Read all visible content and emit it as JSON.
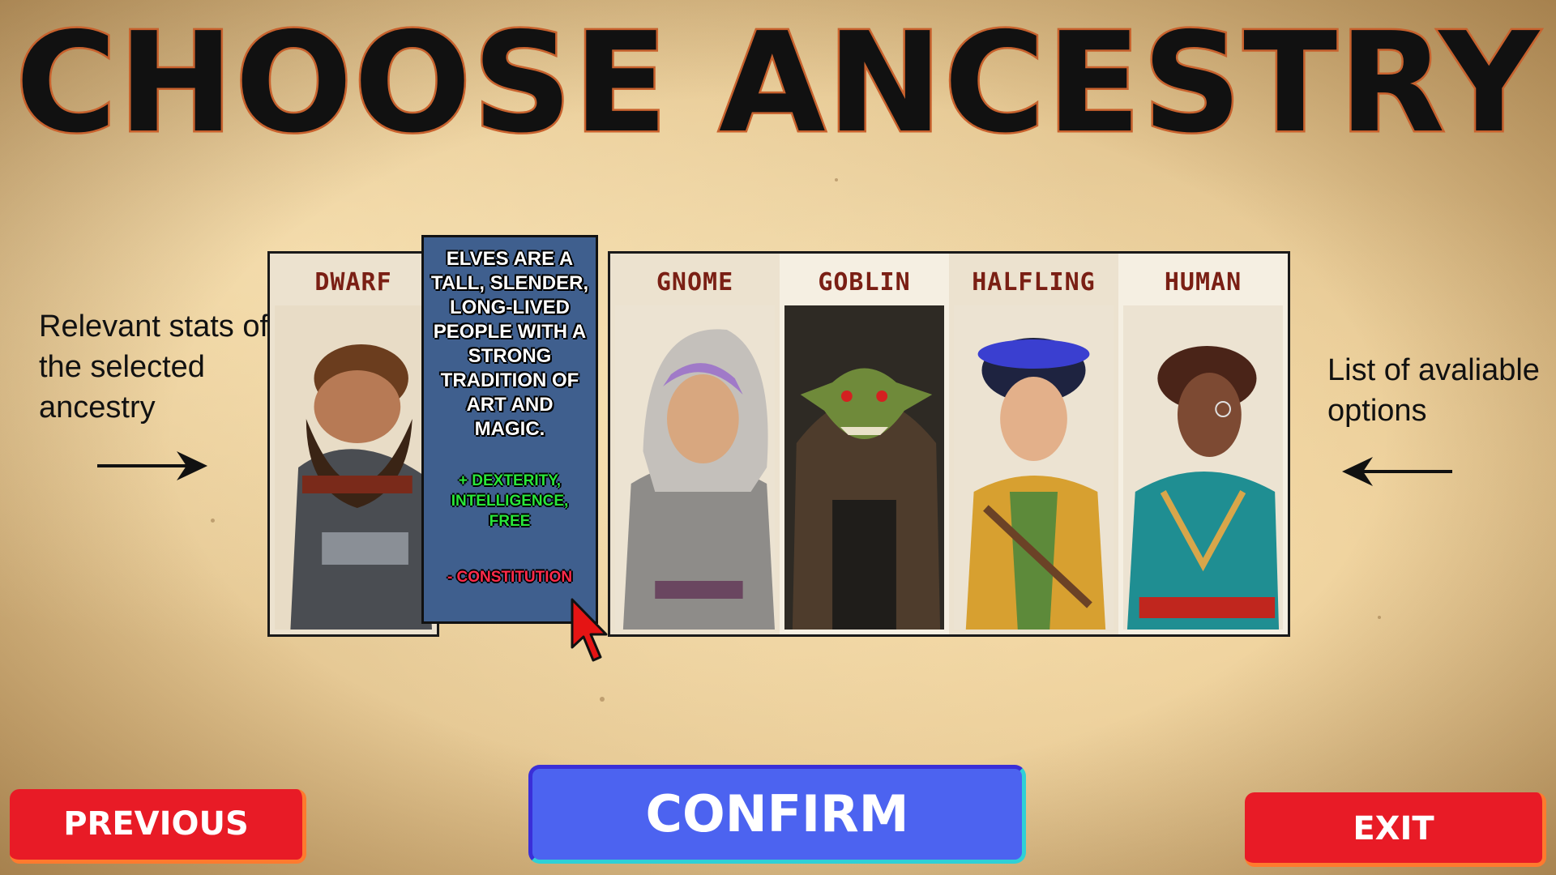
{
  "title": "CHOOSE ANCESTRY",
  "notes": {
    "left": "Relevant stats of the selected ancestry",
    "right": "List of avaliable options"
  },
  "selected_card": {
    "name": "DWARF"
  },
  "info": {
    "description": "ELVES ARE A TALL, SLENDER, LONG-LIVED PEOPLE WITH A STRONG TRADITION OF ART AND MAGIC.",
    "bonus": "+ DEXTERITY, INTELLIGENCE, FREE",
    "penalty": "- CONSTITUTION",
    "bonus_color": "#29e63a",
    "penalty_color": "#ff2a4a"
  },
  "options": [
    {
      "name": "GNOME"
    },
    {
      "name": "GOBLIN"
    },
    {
      "name": "HALFLING"
    },
    {
      "name": "HUMAN"
    }
  ],
  "buttons": {
    "previous": "PREVIOUS",
    "confirm": "CONFIRM",
    "exit": "EXIT"
  },
  "colors": {
    "button_red": "#e81b26",
    "button_blue": "#4c63f0",
    "info_panel": "#3f5f8e",
    "card_label": "#7a1f14",
    "title_outline": "#c8622e"
  }
}
